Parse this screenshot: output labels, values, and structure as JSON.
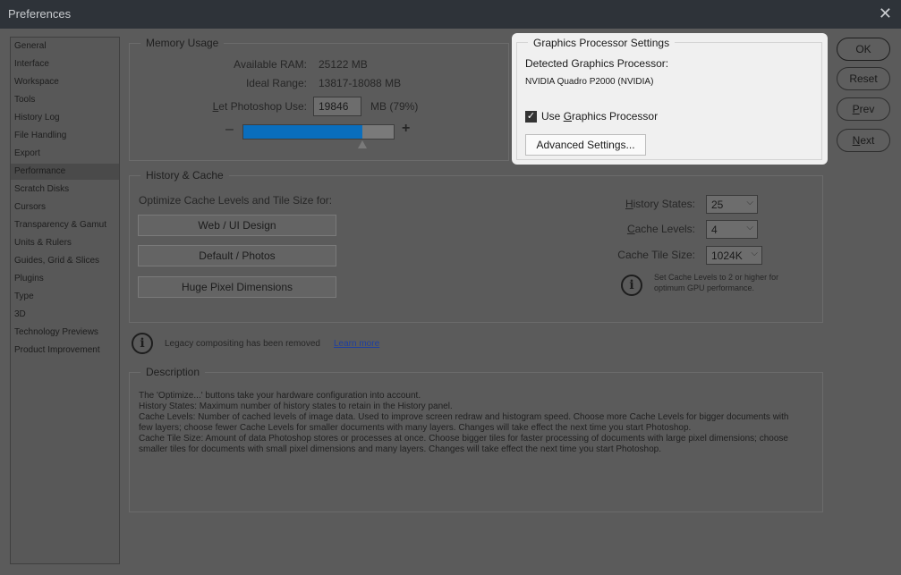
{
  "window": {
    "title": "Preferences"
  },
  "sidebar": {
    "items": [
      {
        "label": "General"
      },
      {
        "label": "Interface"
      },
      {
        "label": "Workspace"
      },
      {
        "label": "Tools"
      },
      {
        "label": "History Log"
      },
      {
        "label": "File Handling"
      },
      {
        "label": "Export"
      },
      {
        "label": "Performance"
      },
      {
        "label": "Scratch Disks"
      },
      {
        "label": "Cursors"
      },
      {
        "label": "Transparency & Gamut"
      },
      {
        "label": "Units & Rulers"
      },
      {
        "label": "Guides, Grid & Slices"
      },
      {
        "label": "Plugins"
      },
      {
        "label": "Type"
      },
      {
        "label": "3D"
      },
      {
        "label": "Technology Previews"
      },
      {
        "label": "Product Improvement"
      }
    ],
    "active_label": "Performance"
  },
  "memory": {
    "legend": "Memory Usage",
    "available_label": "Available RAM:",
    "available_value": "25122 MB",
    "ideal_label": "Ideal Range:",
    "ideal_value": "13817-18088 MB",
    "let_pre": "L",
    "let_rest": "et Photoshop Use:",
    "use_value": "19846",
    "use_suffix": "MB (79%)",
    "minus": "–",
    "plus": "+",
    "slider_fraction": 0.79
  },
  "gpu": {
    "legend": "Graphics Processor Settings",
    "detected_label": "Detected Graphics Processor:",
    "processor_name": "NVIDIA Quadro P2000 (NVIDIA)",
    "use_pre": "Use ",
    "use_u": "G",
    "use_rest": "raphics Processor",
    "use_checked": true,
    "advanced_label": "Advanced Settings..."
  },
  "cache": {
    "legend": "History & Cache",
    "optimize_label": "Optimize Cache Levels and Tile Size for:",
    "btn_web": "Web / UI Design",
    "btn_default": "Default / Photos",
    "btn_huge": "Huge Pixel Dimensions",
    "history_u": "H",
    "history_rest": "istory States:",
    "history_value": "25",
    "levels_u": "C",
    "levels_rest": "ache Levels:",
    "levels_value": "4",
    "tile_label": "Cache Tile Size:",
    "tile_value": "1024K",
    "tip_line1": "Set Cache Levels to 2 or higher for",
    "tip_line2": "optimum GPU performance."
  },
  "legacy": {
    "text": "Legacy compositing has been removed",
    "link": "Learn more"
  },
  "description": {
    "legend": "Description",
    "lines": [
      "The 'Optimize...' buttons take your hardware configuration into account.",
      "History States: Maximum number of history states to retain in the History panel.",
      "Cache Levels: Number of cached levels of image data.  Used to improve screen redraw and histogram speed.  Choose more Cache Levels for bigger documents with",
      "few layers; choose fewer Cache Levels for smaller documents with many layers. Changes will take effect the next time you start Photoshop.",
      "Cache Tile Size: Amount of data Photoshop stores or processes at once. Choose bigger tiles for faster processing of documents with large pixel dimensions; choose",
      "smaller tiles for documents with small pixel dimensions and many layers. Changes will take effect the next time you start Photoshop."
    ]
  },
  "buttons": {
    "ok": "OK",
    "reset": "Reset",
    "prev_u": "P",
    "prev_rest": "rev",
    "next_u": "N",
    "next_rest": "ext"
  },
  "colors": {
    "slider_fill": "#0a6ebd",
    "highlight_panel": "#f0f0f0"
  }
}
